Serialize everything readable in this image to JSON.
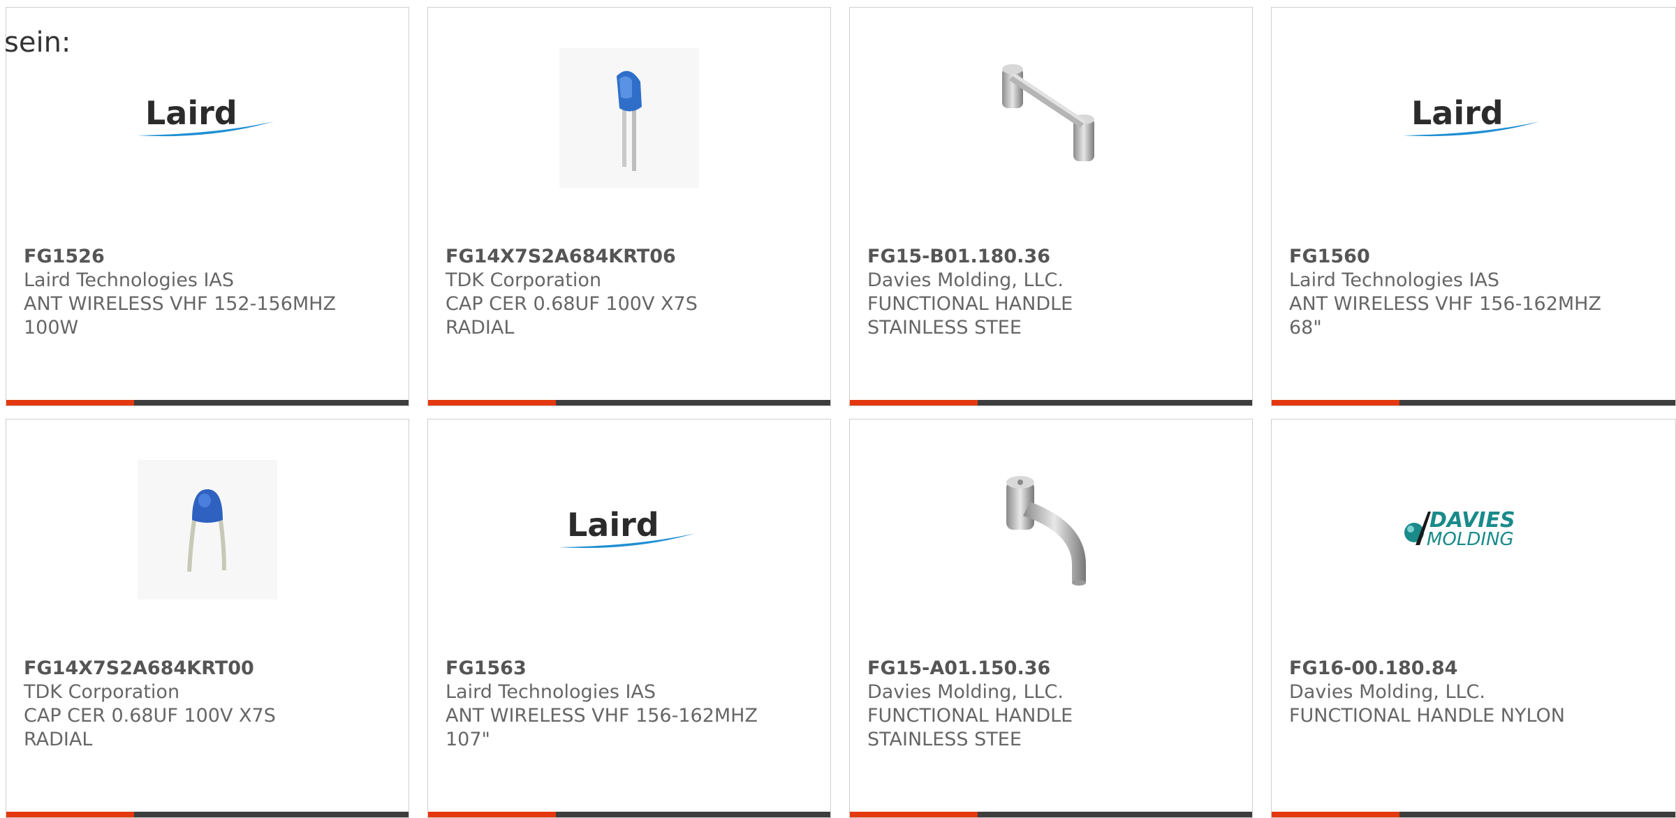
{
  "intro_text": "sein:",
  "colors": {
    "accent": "#e4380e",
    "bar_dark": "#3d3d3d",
    "laird_blue": "#1f8fd3",
    "davies_teal": "#1a8a8a"
  },
  "cards": [
    {
      "part": "FG1526",
      "maker": "Laird Technologies IAS",
      "desc1": "ANT WIRELESS VHF 152-156MHZ",
      "desc2": "100W",
      "image": "laird-logo",
      "logo_text": "Laird"
    },
    {
      "part": "FG14X7S2A684KRT06",
      "maker": "TDK Corporation",
      "desc1": "CAP CER 0.68UF 100V X7S",
      "desc2": "RADIAL",
      "image": "capacitor-photo"
    },
    {
      "part": "FG15-B01.180.36",
      "maker": "Davies Molding, LLC.",
      "desc1": "FUNCTIONAL HANDLE",
      "desc2": "STAINLESS STEE",
      "image": "straight-handle-photo"
    },
    {
      "part": "FG1560",
      "maker": "Laird Technologies IAS",
      "desc1": "ANT WIRELESS VHF 156-162MHZ",
      "desc2": "68\"",
      "image": "laird-logo",
      "logo_text": "Laird"
    },
    {
      "part": "FG14X7S2A684KRT00",
      "maker": "TDK Corporation",
      "desc1": "CAP CER 0.68UF 100V X7S",
      "desc2": "RADIAL",
      "image": "capacitor-photo"
    },
    {
      "part": "FG1563",
      "maker": "Laird Technologies IAS",
      "desc1": "ANT WIRELESS VHF 156-162MHZ",
      "desc2": "107\"",
      "image": "laird-logo",
      "logo_text": "Laird"
    },
    {
      "part": "FG15-A01.150.36",
      "maker": "Davies Molding, LLC.",
      "desc1": "FUNCTIONAL HANDLE",
      "desc2": "STAINLESS STEE",
      "image": "bent-handle-photo"
    },
    {
      "part": "FG16-00.180.84",
      "maker": "Davies Molding, LLC.",
      "desc1": "FUNCTIONAL HANDLE NYLON",
      "desc2": "",
      "image": "davies-logo",
      "logo_text_1": "DAVIES",
      "logo_text_2": "MOLDING"
    }
  ]
}
